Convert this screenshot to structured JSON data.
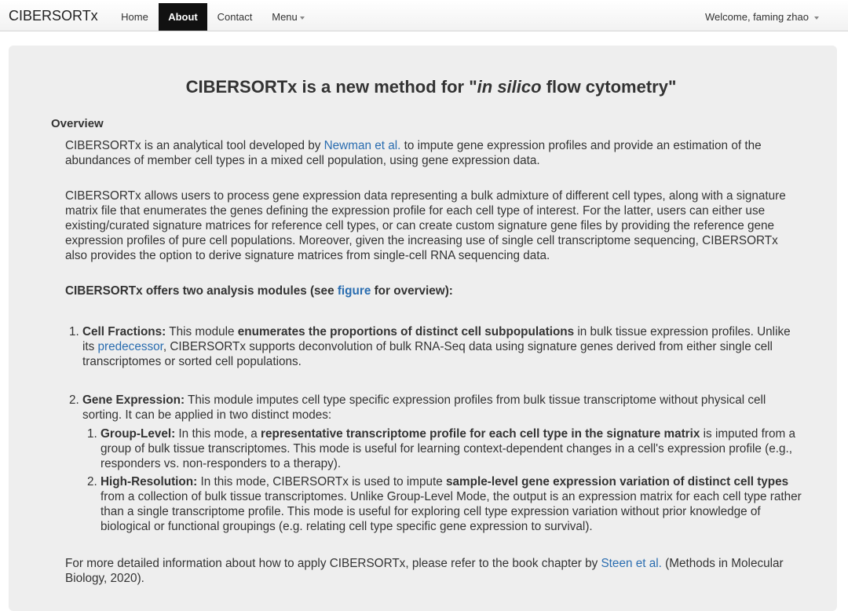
{
  "navbar": {
    "brand": "CIBERSORTx",
    "home": "Home",
    "about": "About",
    "contact": "Contact",
    "menu": "Menu",
    "user": "Welcome, faming zhao"
  },
  "headline": {
    "prefix": "CIBERSORTx is a new method for \"",
    "italic": "in silico",
    "suffix": " flow cytometry\""
  },
  "overview": {
    "title": "Overview",
    "p1_a": "CIBERSORTx is an analytical tool developed by ",
    "p1_link": "Newman et al.",
    "p1_b": " to impute gene expression profiles and provide an estimation of the abundances of member cell types in a mixed cell population, using gene expression data.",
    "p2": "CIBERSORTx allows users to process gene expression data representing a bulk admixture of different cell types, along with a signature matrix file that enumerates the genes defining the expression profile for each cell type of interest. For the latter, users can either use existing/curated signature matrices for reference cell types, or can create custom signature gene files by providing the reference gene expression profiles of pure cell populations. Moreover, given the increasing use of single cell transcriptome sequencing, CIBERSORTx also provides the option to derive signature matrices from single-cell RNA sequencing data.",
    "p3_a": "CIBERSORTx offers two analysis modules (see ",
    "p3_link": "figure",
    "p3_b": " for overview):"
  },
  "modules": [
    {
      "num": "1.",
      "title": "Cell Fractions:",
      "t1": " This module ",
      "b1": "enumerates the proportions of distinct cell subpopulations",
      "t2": " in bulk tissue expression profiles. Unlike its ",
      "link": "predecessor",
      "t3": ", CIBERSORTx supports deconvolution of bulk RNA-Seq data using signature genes derived from either single cell transcriptomes or sorted cell populations."
    },
    {
      "num": "2.",
      "title": "Gene Expression:",
      "t1": " This module imputes cell type specific expression profiles from bulk tissue transcriptome without physical cell sorting. It can be applied in two distinct modes:"
    }
  ],
  "modes": [
    {
      "num": "1.",
      "title": "Group-Level:",
      "t1": " In this mode, a ",
      "b1": "representative transcriptome profile for each cell type in the signature matrix",
      "t2": " is imputed from a group of bulk tissue transcriptomes. This mode is useful for learning context-dependent changes in a cell's expression profile (e.g., responders vs. non-responders to a therapy)."
    },
    {
      "num": "2.",
      "title": "High-Resolution:",
      "t1": " In this mode, CIBERSORTx is used to impute ",
      "b1": "sample-level gene expression variation of distinct cell types",
      "t2": " from a collection of bulk tissue transcriptomes. Unlike Group-Level Mode, the output is an expression matrix for each cell type rather than a single transcriptome profile. This mode is useful for exploring cell type expression variation without prior knowledge of biological or functional groupings (e.g. relating cell type specific gene expression to survival)."
    }
  ],
  "footer_note": {
    "a": "For more detailed information about how to apply CIBERSORTx, please refer to the book chapter by ",
    "link": "Steen et al.",
    "b": " (Methods in Molecular Biology, 2020)."
  },
  "colors": {
    "link": "#2a6db0",
    "active_nav": "#111111",
    "well_bg": "#eeeeee"
  }
}
